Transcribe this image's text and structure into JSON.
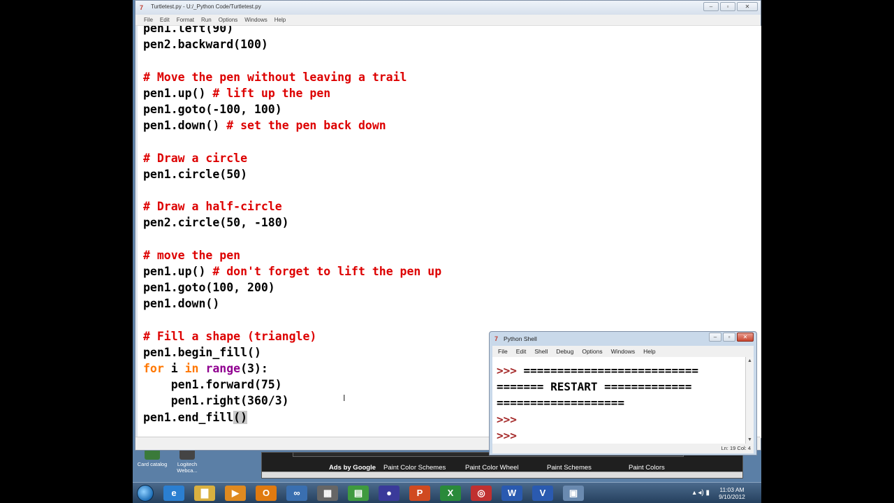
{
  "editor": {
    "title": "Turtletest.py - U:/_Python Code/Turtletest.py",
    "menu": [
      "File",
      "Edit",
      "Format",
      "Run",
      "Options",
      "Windows",
      "Help"
    ],
    "code_lines": [
      [
        {
          "t": "pen1.left(90)",
          "c": ""
        }
      ],
      [
        {
          "t": "pen2.backward(100)",
          "c": ""
        }
      ],
      [
        {
          "t": "",
          "c": ""
        }
      ],
      [
        {
          "t": "# Move the pen without leaving a trail",
          "c": "cmt"
        }
      ],
      [
        {
          "t": "pen1.up() ",
          "c": ""
        },
        {
          "t": "# lift up the pen",
          "c": "cmt"
        }
      ],
      [
        {
          "t": "pen1.goto(-100, 100)",
          "c": ""
        }
      ],
      [
        {
          "t": "pen1.down() ",
          "c": ""
        },
        {
          "t": "# set the pen back down",
          "c": "cmt"
        }
      ],
      [
        {
          "t": "",
          "c": ""
        }
      ],
      [
        {
          "t": "# Draw a circle",
          "c": "cmt"
        }
      ],
      [
        {
          "t": "pen1.circle(50)",
          "c": ""
        }
      ],
      [
        {
          "t": "",
          "c": ""
        }
      ],
      [
        {
          "t": "# Draw a half-circle",
          "c": "cmt"
        }
      ],
      [
        {
          "t": "pen2.circle(50, -180)",
          "c": ""
        }
      ],
      [
        {
          "t": "",
          "c": ""
        }
      ],
      [
        {
          "t": "# move the pen",
          "c": "cmt"
        }
      ],
      [
        {
          "t": "pen1.up() ",
          "c": ""
        },
        {
          "t": "# don't forget to lift the pen up",
          "c": "cmt"
        }
      ],
      [
        {
          "t": "pen1.goto(100, 200)",
          "c": ""
        }
      ],
      [
        {
          "t": "pen1.down()",
          "c": ""
        }
      ],
      [
        {
          "t": "",
          "c": ""
        }
      ],
      [
        {
          "t": "# Fill a shape (triangle)",
          "c": "cmt"
        }
      ],
      [
        {
          "t": "pen1.begin_fill()",
          "c": ""
        }
      ],
      [
        {
          "t": "for",
          "c": "kw"
        },
        {
          "t": " i ",
          "c": ""
        },
        {
          "t": "in",
          "c": "kw"
        },
        {
          "t": " ",
          "c": ""
        },
        {
          "t": "range",
          "c": "bi"
        },
        {
          "t": "(3):",
          "c": ""
        }
      ],
      [
        {
          "t": "    pen1.forward(75)",
          "c": ""
        }
      ],
      [
        {
          "t": "    pen1.right(360/3)",
          "c": ""
        }
      ],
      [
        {
          "t": "pen1.end_fill",
          "c": ""
        },
        {
          "t": "()",
          "c": "hl"
        }
      ]
    ]
  },
  "shell": {
    "title": "Python Shell",
    "menu": [
      "File",
      "Edit",
      "Shell",
      "Debug",
      "Options",
      "Windows",
      "Help"
    ],
    "lines": [
      [
        {
          "t": ">>> ",
          "c": "prompt"
        },
        {
          "t": "==========================",
          "c": ""
        }
      ],
      [
        {
          "t": "======= RESTART =============",
          "c": ""
        }
      ],
      [
        {
          "t": "===================",
          "c": ""
        }
      ],
      [
        {
          "t": ">>> ",
          "c": "prompt"
        }
      ],
      [
        {
          "t": ">>> ",
          "c": "prompt"
        }
      ]
    ],
    "status": "Ln: 19 Col: 4"
  },
  "desktop_icons": [
    {
      "label": "Card catalog",
      "color": "#3a7a3a"
    },
    {
      "label": "Logitech Webca...",
      "color": "#444"
    }
  ],
  "ad_links": {
    "ads_label": "Ads by Google",
    "links": [
      "Paint Color Schemes",
      "Paint Color Wheel",
      "Paint Schemes",
      "Paint Colors"
    ]
  },
  "taskbar": {
    "apps": [
      {
        "name": "ie-icon",
        "glyph": "e",
        "color": "#2b7fd1"
      },
      {
        "name": "explorer-icon",
        "glyph": "▇",
        "color": "#d9b040"
      },
      {
        "name": "media-player-icon",
        "glyph": "▶",
        "color": "#e08a20"
      },
      {
        "name": "outlook-icon",
        "glyph": "O",
        "color": "#e07a10"
      },
      {
        "name": "network-icon",
        "glyph": "∞",
        "color": "#3a6fb0"
      },
      {
        "name": "calculator-icon",
        "glyph": "▦",
        "color": "#666"
      },
      {
        "name": "project-icon",
        "glyph": "▤",
        "color": "#3f9a3f"
      },
      {
        "name": "eclipse-icon",
        "glyph": "●",
        "color": "#3a3a9a"
      },
      {
        "name": "powerpoint-icon",
        "glyph": "P",
        "color": "#d04a20"
      },
      {
        "name": "excel-icon",
        "glyph": "X",
        "color": "#2a8a3a"
      },
      {
        "name": "chrome-icon",
        "glyph": "◎",
        "color": "#c03030"
      },
      {
        "name": "word-icon",
        "glyph": "W",
        "color": "#2a5ab0"
      },
      {
        "name": "visio-icon",
        "glyph": "V",
        "color": "#2a5ab0"
      },
      {
        "name": "python-icon",
        "glyph": "▣",
        "color": "#6a8ab0"
      }
    ],
    "clock_time": "11:03 AM",
    "clock_date": "9/10/2012"
  }
}
